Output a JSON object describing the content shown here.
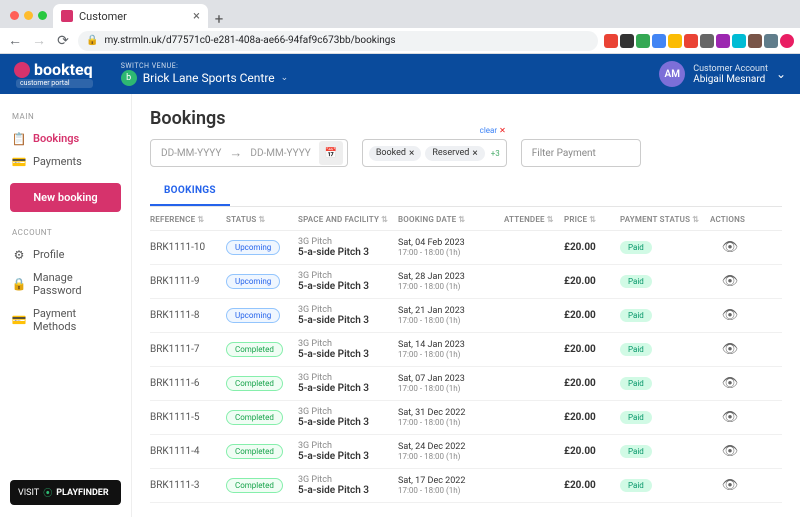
{
  "browser": {
    "tab_title": "Customer",
    "url": "my.strmln.uk/d77571c0-e281-408a-ae66-94faf9c673bb/bookings"
  },
  "header": {
    "logo": "bookteq",
    "portal_tag": "customer portal",
    "switch_label": "SWITCH VENUE:",
    "venue_initial": "b",
    "venue_name": "Brick Lane Sports Centre",
    "account_label": "Customer Account",
    "account_name": "Abigail Mesnard",
    "avatar_initials": "AM"
  },
  "sidebar": {
    "section1": "MAIN",
    "bookings": "Bookings",
    "payments": "Payments",
    "new_booking": "New booking",
    "section2": "ACCOUNT",
    "profile": "Profile",
    "manage_password": "Manage Password",
    "payment_methods": "Payment Methods",
    "visit": "VISIT",
    "playfinder": "PLAYFINDER"
  },
  "page": {
    "title": "Bookings",
    "date_placeholder1": "DD-MM-YYYY",
    "date_placeholder2": "DD-MM-YYYY",
    "chip_booked": "Booked",
    "chip_reserved": "Reserved",
    "chip_more": "+3",
    "clear": "clear",
    "filter_payment": "Filter Payment",
    "tab_bookings": "BOOKINGS"
  },
  "columns": {
    "reference": "REFERENCE",
    "status": "STATUS",
    "facility": "SPACE AND FACILITY",
    "booking_date": "BOOKING DATE",
    "attendee": "ATTENDEE",
    "price": "PRICE",
    "payment_status": "PAYMENT STATUS",
    "actions": "ACTIONS"
  },
  "rows": [
    {
      "ref": "BRK1111-10",
      "status": "Upcoming",
      "status_class": "status-upcoming",
      "f1": "3G Pitch",
      "f2": "5-a-side Pitch 3",
      "d1": "Sat, 04 Feb 2023",
      "d2": "17:00 - 18:00 (1h)",
      "price": "£20.00",
      "pay": "Paid"
    },
    {
      "ref": "BRK1111-9",
      "status": "Upcoming",
      "status_class": "status-upcoming",
      "f1": "3G Pitch",
      "f2": "5-a-side Pitch 3",
      "d1": "Sat, 28 Jan 2023",
      "d2": "17:00 - 18:00 (1h)",
      "price": "£20.00",
      "pay": "Paid"
    },
    {
      "ref": "BRK1111-8",
      "status": "Upcoming",
      "status_class": "status-upcoming",
      "f1": "3G Pitch",
      "f2": "5-a-side Pitch 3",
      "d1": "Sat, 21 Jan 2023",
      "d2": "17:00 - 18:00 (1h)",
      "price": "£20.00",
      "pay": "Paid"
    },
    {
      "ref": "BRK1111-7",
      "status": "Completed",
      "status_class": "status-completed",
      "f1": "3G Pitch",
      "f2": "5-a-side Pitch 3",
      "d1": "Sat, 14 Jan 2023",
      "d2": "17:00 - 18:00 (1h)",
      "price": "£20.00",
      "pay": "Paid"
    },
    {
      "ref": "BRK1111-6",
      "status": "Completed",
      "status_class": "status-completed",
      "f1": "3G Pitch",
      "f2": "5-a-side Pitch 3",
      "d1": "Sat, 07 Jan 2023",
      "d2": "17:00 - 18:00 (1h)",
      "price": "£20.00",
      "pay": "Paid"
    },
    {
      "ref": "BRK1111-5",
      "status": "Completed",
      "status_class": "status-completed",
      "f1": "3G Pitch",
      "f2": "5-a-side Pitch 3",
      "d1": "Sat, 31 Dec 2022",
      "d2": "17:00 - 18:00 (1h)",
      "price": "£20.00",
      "pay": "Paid"
    },
    {
      "ref": "BRK1111-4",
      "status": "Completed",
      "status_class": "status-completed",
      "f1": "3G Pitch",
      "f2": "5-a-side Pitch 3",
      "d1": "Sat, 24 Dec 2022",
      "d2": "17:00 - 18:00 (1h)",
      "price": "£20.00",
      "pay": "Paid"
    },
    {
      "ref": "BRK1111-3",
      "status": "Completed",
      "status_class": "status-completed",
      "f1": "3G Pitch",
      "f2": "5-a-side Pitch 3",
      "d1": "Sat, 17 Dec 2022",
      "d2": "17:00 - 18:00 (1h)",
      "price": "£20.00",
      "pay": "Paid"
    }
  ]
}
